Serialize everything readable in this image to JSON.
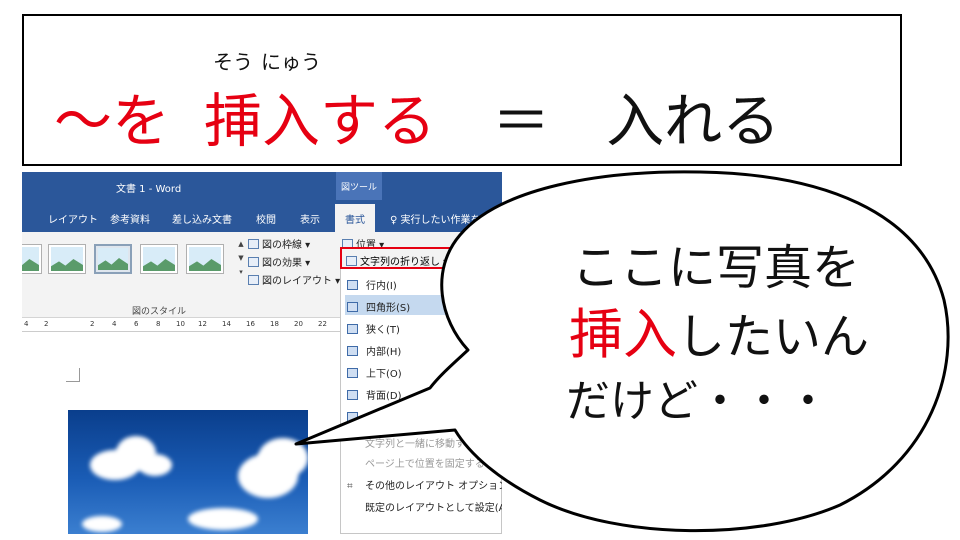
{
  "slide": {
    "phrase": {
      "tilde_wo": "〜を",
      "sou_nyuu_1": "挿",
      "sou_nyuu_2": "入",
      "suru": "する",
      "equals": "＝",
      "ireru": "入れる",
      "ruby_1": "そう",
      "ruby_2": "にゅう"
    },
    "bubble": {
      "line1": "ここに写真を",
      "line2_red": "挿入",
      "line2_rest": "したいん",
      "line3": "だけど・・・"
    }
  },
  "word": {
    "title": "文書 1  -  Word",
    "tool_tab": "図ツール",
    "tabs": [
      "レイアウト",
      "参考資料",
      "差し込み文書",
      "校閲",
      "表示"
    ],
    "active_tab": "書式",
    "tell_me": "実行したい作業を入力し",
    "ribbon": {
      "picture_border": "図の枠線 ▾",
      "picture_effects": "図の効果 ▾",
      "picture_layout": "図のレイアウト ▾",
      "position": "位置 ▾",
      "wrap_text": "文字列の折り返し ▾",
      "styles_group": "図のスタイル",
      "back": "背面"
    },
    "ruler": [
      "4",
      "2",
      "2",
      "4",
      "6",
      "8",
      "10",
      "12",
      "14",
      "16",
      "18",
      "20",
      "22"
    ],
    "menu": [
      {
        "label": "行内(I)",
        "state": "normal"
      },
      {
        "label": "四角形(S)",
        "state": "highlight"
      },
      {
        "label": "狭く(T)",
        "state": "normal"
      },
      {
        "label": "内部(H)",
        "state": "normal"
      },
      {
        "label": "上下(O)",
        "state": "normal"
      },
      {
        "label": "背面(D)",
        "state": "normal"
      },
      {
        "label": "前面",
        "state": "normal"
      },
      {
        "label": "文字列と一緒に移動する",
        "state": "dim"
      },
      {
        "label": "ページ上で位置を固定する",
        "state": "dim"
      },
      {
        "label": "その他のレイアウト オプション(L)...",
        "state": "normal"
      },
      {
        "label": "既定のレイアウトとして設定(A)",
        "state": "normal"
      }
    ]
  },
  "colors": {
    "accent_red": "#e60012",
    "word_blue": "#2b579a"
  }
}
